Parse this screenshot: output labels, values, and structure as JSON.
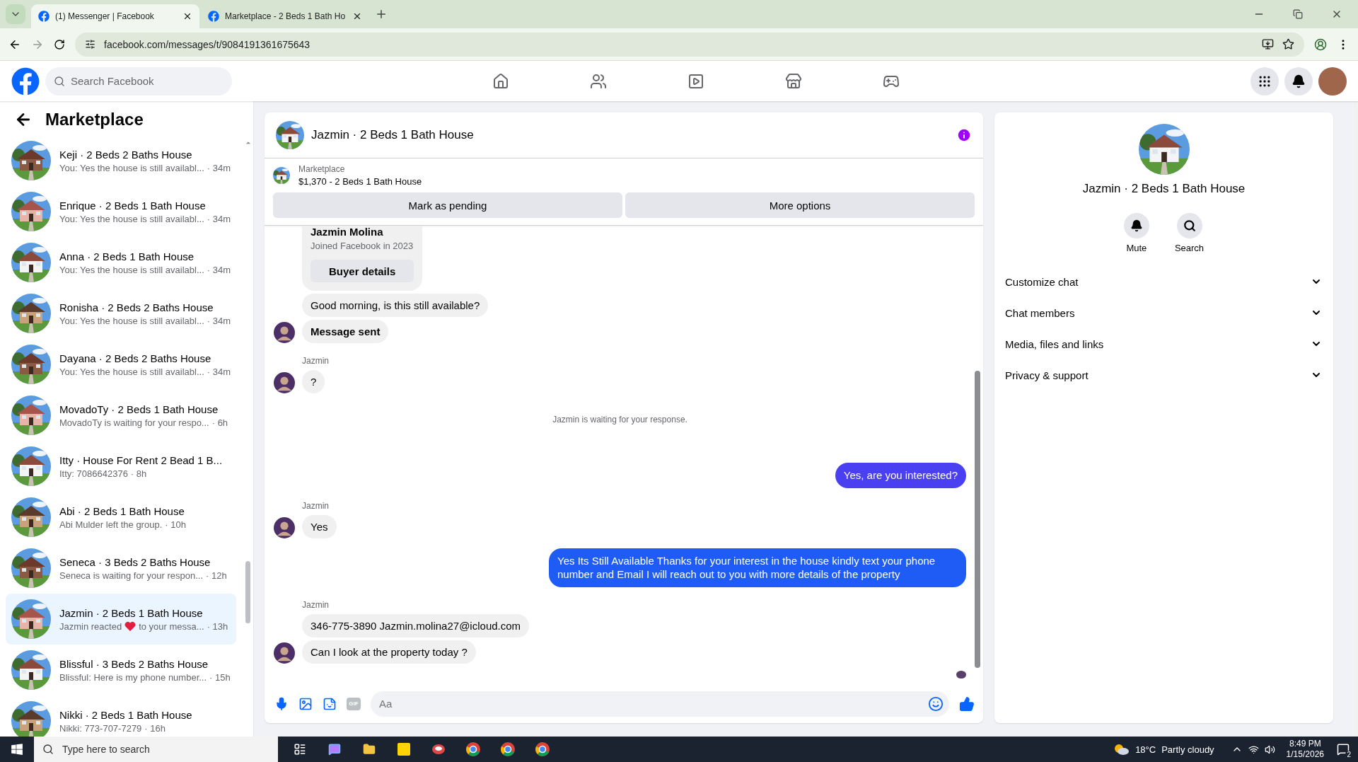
{
  "browser": {
    "tabs": [
      {
        "title": "(1) Messenger | Facebook",
        "selected": true
      },
      {
        "title": "Marketplace - 2 Beds 1 Bath Ho",
        "selected": false
      }
    ],
    "url": "facebook.com/messages/t/9084191361675643"
  },
  "header": {
    "search_placeholder": "Search Facebook"
  },
  "sidebar": {
    "title": "Marketplace",
    "conversations": [
      {
        "name": "Keji · 2 Beds 2 Baths House",
        "kind": "text",
        "preview": "You: Yes the house is still availabl...",
        "time": "· 34m",
        "selected": false
      },
      {
        "name": "Enrique · 2 Beds 1 Bath House",
        "kind": "text",
        "preview": "You: Yes the house is still availabl...",
        "time": "· 34m",
        "selected": false
      },
      {
        "name": "Anna · 2 Beds 1 Bath House",
        "kind": "text",
        "preview": "You: Yes the house is still availabl...",
        "time": "· 34m",
        "selected": false
      },
      {
        "name": "Ronisha · 2 Beds 2 Baths House",
        "kind": "text",
        "preview": "You: Yes the house is still availabl...",
        "time": "· 34m",
        "selected": false
      },
      {
        "name": "Dayana · 2 Beds 2 Baths House",
        "kind": "text",
        "preview": "You: Yes the house is still availabl...",
        "time": "· 34m",
        "selected": false
      },
      {
        "name": "MovadoTy · 2 Beds 1 Bath House",
        "kind": "text",
        "preview": "MovadoTy is waiting for your respo...",
        "time": "· 6h",
        "selected": false
      },
      {
        "name": "Itty · House For Rent 2 Bead 1 B...",
        "kind": "text",
        "preview": "Itty: 7086642376",
        "time": "· 8h",
        "selected": false
      },
      {
        "name": "Abi · 2 Beds 1 Bath House",
        "kind": "text",
        "preview": "Abi Mulder left the group.",
        "time": "· 10h",
        "selected": false
      },
      {
        "name": "Seneca · 3 Beds 2 Baths House",
        "kind": "text",
        "preview": "Seneca is waiting for your respon...",
        "time": "· 12h",
        "selected": false
      },
      {
        "name": "Jazmin · 2 Beds 1 Bath House",
        "kind": "reaction",
        "preview": "Jazmin reacted",
        "preview_after": "to your messa...",
        "time": "· 13h",
        "selected": true
      },
      {
        "name": "Blissful · 3 Beds 2 Baths House",
        "kind": "text",
        "preview": "Blissful: Here is my phone number...",
        "time": "· 15h",
        "selected": false
      },
      {
        "name": "Nikki · 2 Beds 1 Bath House",
        "kind": "text",
        "preview": "Nikki: 773-707-7279",
        "time": "· 16h",
        "selected": false
      }
    ]
  },
  "chat": {
    "title": "Jazmin · 2 Beds 1 Bath House",
    "listing": {
      "label": "Marketplace",
      "detail": "$1,370 - 2 Beds 1 Bath House"
    },
    "actions": [
      "Mark as pending",
      "More options"
    ],
    "messages": [
      {
        "kind": "profile_card",
        "name": "Jazmin Molina",
        "subtitle": "Joined Facebook in 2023",
        "button": "Buyer details"
      },
      {
        "kind": "incoming",
        "text": "Good morning, is this still available?",
        "show_avatar": false
      },
      {
        "kind": "incoming",
        "text": "Message sent",
        "bold": true,
        "show_avatar": true
      },
      {
        "kind": "incoming",
        "sender": "Jazmin",
        "text": "?",
        "show_avatar": true
      },
      {
        "kind": "system",
        "text": "Jazmin is waiting for your response."
      },
      {
        "kind": "outgoing",
        "text": "Yes, are you interested?",
        "color": "#4b3ff2"
      },
      {
        "kind": "incoming",
        "sender": "Jazmin",
        "text": "Yes",
        "show_avatar": true
      },
      {
        "kind": "outgoing",
        "text": "Yes Its Still Available Thanks for your interest in the house kindly text your phone number and Email I will reach out to you with more details of the property",
        "color": "#1f5cf6"
      },
      {
        "kind": "incoming",
        "sender": "Jazmin",
        "text": "346-775-3890 Jazmin.molina27@icloud.com",
        "show_avatar": false
      },
      {
        "kind": "incoming",
        "text": "Can I look at the property today ?",
        "show_avatar": true
      }
    ],
    "composer": {
      "gif_label": "GIF",
      "placeholder": "Aa"
    }
  },
  "details": {
    "title": "Jazmin · 2 Beds 1 Bath House",
    "actions": [
      {
        "kind": "mute",
        "label": "Mute"
      },
      {
        "kind": "search",
        "label": "Search"
      }
    ],
    "sections": [
      {
        "label": "Customize chat",
        "expanded": false
      },
      {
        "label": "Chat members",
        "expanded": false
      },
      {
        "label": "Media, files and links",
        "expanded": false
      },
      {
        "label": "Privacy & support",
        "expanded": false
      }
    ]
  },
  "taskbar": {
    "search_placeholder": "Type here to search",
    "temperature": "18°C",
    "weather": "Partly cloudy",
    "time": "8:49 PM",
    "date": "1/15/2026",
    "notifications": "2"
  }
}
